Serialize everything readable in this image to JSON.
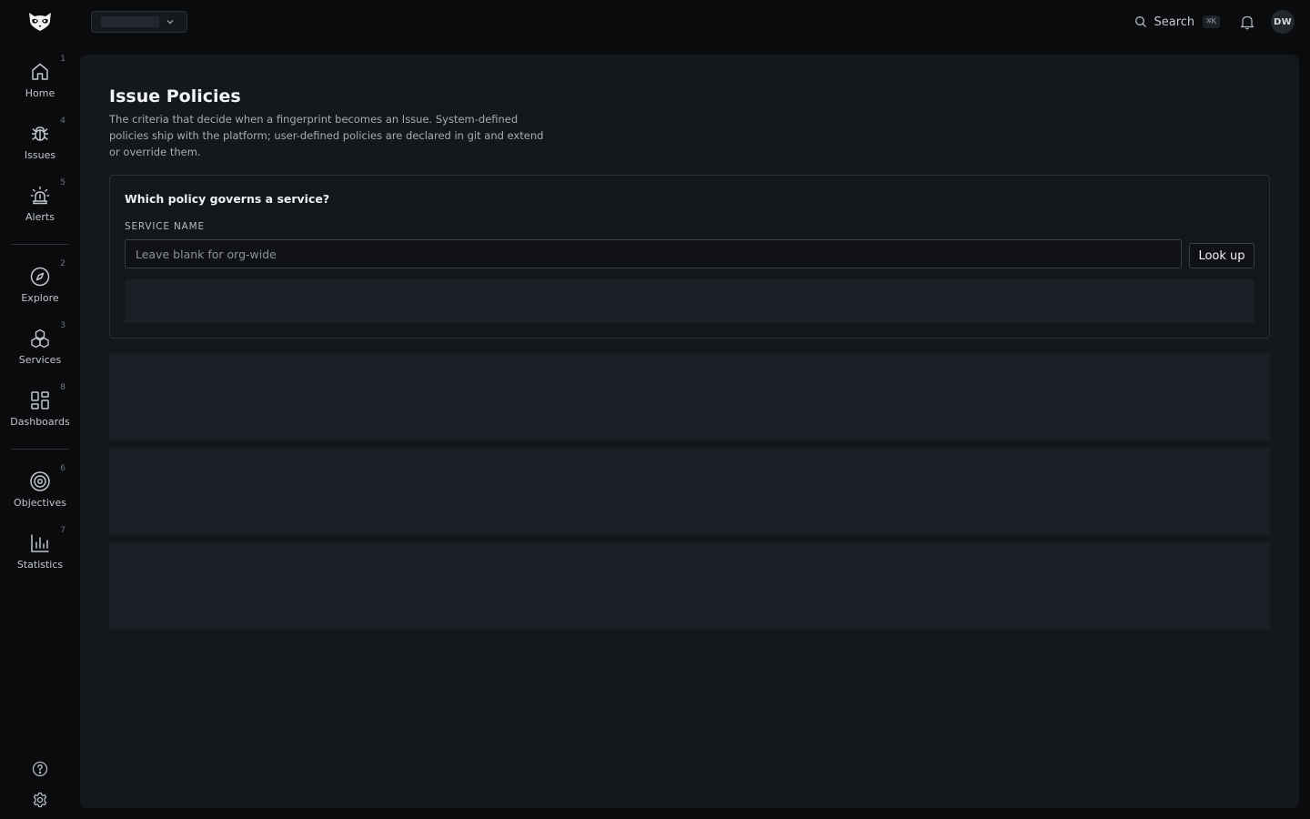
{
  "topbar": {
    "search_label": "Search",
    "search_shortcut": "⌘K",
    "avatar_initials": "DW"
  },
  "sidebar": {
    "items": [
      {
        "label": "Home",
        "shortcut": "1",
        "icon": "home-icon"
      },
      {
        "label": "Issues",
        "shortcut": "4",
        "icon": "bug-icon"
      },
      {
        "label": "Alerts",
        "shortcut": "5",
        "icon": "siren-icon"
      },
      {
        "label": "Explore",
        "shortcut": "2",
        "icon": "compass-icon"
      },
      {
        "label": "Services",
        "shortcut": "3",
        "icon": "boxes-icon"
      },
      {
        "label": "Dashboards",
        "shortcut": "8",
        "icon": "grid-icon"
      },
      {
        "label": "Objectives",
        "shortcut": "6",
        "icon": "target-icon"
      },
      {
        "label": "Statistics",
        "shortcut": "7",
        "icon": "bar-chart-icon"
      }
    ],
    "bottom": [
      "help-icon",
      "gear-icon"
    ]
  },
  "page": {
    "title": "Issue Policies",
    "description": "The criteria that decide when a fingerprint becomes an Issue. System-defined policies ship with the platform; user-defined policies are declared in git and extend or override them."
  },
  "lookup": {
    "question": "Which policy governs a service?",
    "field_label": "SERVICE NAME",
    "placeholder": "Leave blank for org-wide",
    "value": "",
    "button_label": "Look up"
  },
  "colors": {
    "background": "#0a0b0d",
    "panel": "#14171c",
    "skeleton": "#1b1f25",
    "border": "#2a2e35"
  }
}
